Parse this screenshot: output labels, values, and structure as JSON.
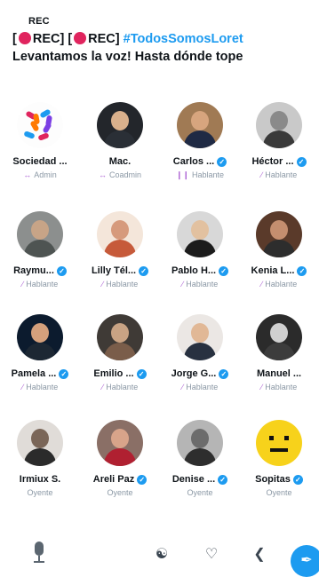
{
  "header": {
    "rec_tag": "REC",
    "title_prefix_1": "[",
    "title_rec_1": "REC] [",
    "title_rec_2": "REC]",
    "hashtag": "#TodosSomosLoret",
    "title_line_2": "Levantamos la voz! Hasta dónde tope"
  },
  "colors": {
    "accent": "#1d9bf0",
    "rec_dot": "#e0245e",
    "role_icon": "#b06ad6"
  },
  "speakers": [
    {
      "name": "Sociedad ...",
      "role": "Admin",
      "verified": false,
      "role_icon": "host-icon"
    },
    {
      "name": "Mac.",
      "role": "Coadmin",
      "verified": false,
      "role_icon": "cohost-icon"
    },
    {
      "name": "Carlos ...",
      "role": "Hablante",
      "verified": true,
      "role_icon": "speaking-icon"
    },
    {
      "name": "Héctor ...",
      "role": "Hablante",
      "verified": true,
      "role_icon": "muted-mic-icon"
    },
    {
      "name": "Raymu...",
      "role": "Hablante",
      "verified": true,
      "role_icon": "muted-mic-icon"
    },
    {
      "name": "Lilly Tél...",
      "role": "Hablante",
      "verified": true,
      "role_icon": "muted-mic-icon"
    },
    {
      "name": "Pablo H...",
      "role": "Hablante",
      "verified": true,
      "role_icon": "muted-mic-icon"
    },
    {
      "name": "Kenia L...",
      "role": "Hablante",
      "verified": true,
      "role_icon": "muted-mic-icon"
    },
    {
      "name": "Pamela ...",
      "role": "Hablante",
      "verified": true,
      "role_icon": "muted-mic-icon"
    },
    {
      "name": "Emilio ...",
      "role": "Hablante",
      "verified": true,
      "role_icon": "muted-mic-icon"
    },
    {
      "name": "Jorge G...",
      "role": "Hablante",
      "verified": true,
      "role_icon": "muted-mic-icon"
    },
    {
      "name": "Manuel ...",
      "role": "Hablante",
      "verified": false,
      "role_icon": "muted-mic-icon"
    },
    {
      "name": "Irmiux S.",
      "role": "Oyente",
      "verified": false,
      "role_icon": ""
    },
    {
      "name": "Areli Paz",
      "role": "Oyente",
      "verified": true,
      "role_icon": ""
    },
    {
      "name": "Denise ...",
      "role": "Oyente",
      "verified": true,
      "role_icon": ""
    },
    {
      "name": "Sopitas",
      "role": "Oyente",
      "verified": true,
      "role_icon": ""
    }
  ],
  "toolbar": {
    "mic_icon": "microphone-icon",
    "people_icon": "people-icon",
    "react_icon": "heart-plus-icon",
    "share_icon": "share-icon",
    "compose_icon": "compose-icon"
  }
}
